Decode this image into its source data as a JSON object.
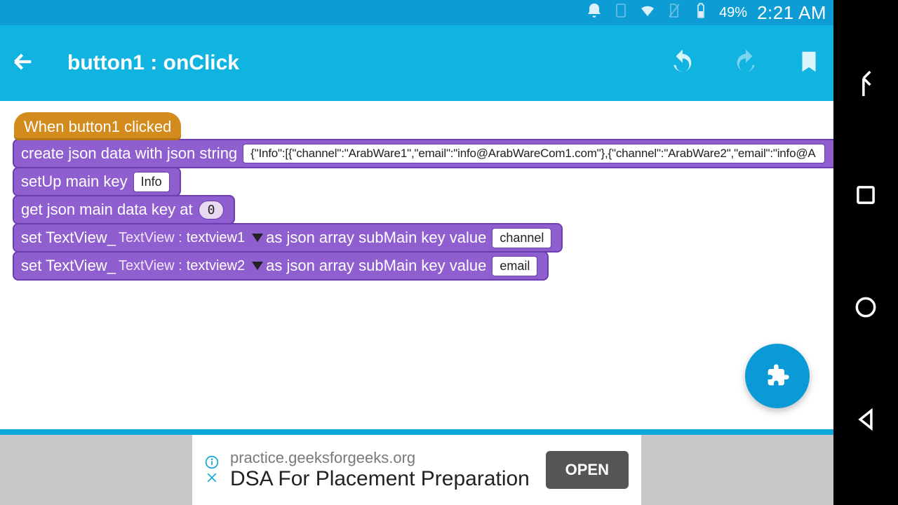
{
  "status": {
    "battery": "49%",
    "clock": "2:21 AM"
  },
  "appbar": {
    "title": "button1 : onClick"
  },
  "blocks": {
    "hat": "When button1 clicked",
    "b1": {
      "label": "create json data with json string",
      "value": "{\"Info\":[{\"channel\":\"ArabWare1\",\"email\":\"info@ArabWareCom1.com\"},{\"channel\":\"ArabWare2\",\"email\":\"info@A"
    },
    "b2": {
      "label": "setUp main key",
      "value": "Info"
    },
    "b3": {
      "label": "get json main data key at",
      "value": "0"
    },
    "b4": {
      "label_pre": "set TextView_",
      "dd_prefix": "TextView :",
      "dd_value": "textview1",
      "label_mid": "as json array subMain key value",
      "value": "channel"
    },
    "b5": {
      "label_pre": "set TextView_",
      "dd_prefix": "TextView :",
      "dd_value": "textview2",
      "label_mid": "as json array subMain key value",
      "value": "email"
    }
  },
  "ad": {
    "domain": "practice.geeksforgeeks.org",
    "title": "DSA For Placement Preparation",
    "cta": "OPEN"
  }
}
